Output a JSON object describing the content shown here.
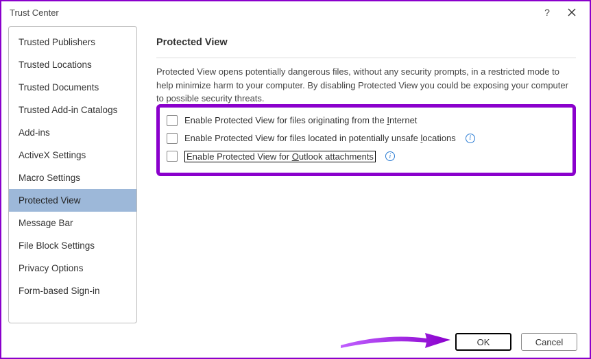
{
  "window": {
    "title": "Trust Center"
  },
  "sidebar": {
    "items": [
      {
        "label": "Trusted Publishers",
        "selected": false
      },
      {
        "label": "Trusted Locations",
        "selected": false
      },
      {
        "label": "Trusted Documents",
        "selected": false
      },
      {
        "label": "Trusted Add-in Catalogs",
        "selected": false
      },
      {
        "label": "Add-ins",
        "selected": false
      },
      {
        "label": "ActiveX Settings",
        "selected": false
      },
      {
        "label": "Macro Settings",
        "selected": false
      },
      {
        "label": "Protected View",
        "selected": true
      },
      {
        "label": "Message Bar",
        "selected": false
      },
      {
        "label": "File Block Settings",
        "selected": false
      },
      {
        "label": "Privacy Options",
        "selected": false
      },
      {
        "label": "Form-based Sign-in",
        "selected": false
      }
    ]
  },
  "main": {
    "heading": "Protected View",
    "description": "Protected View opens potentially dangerous files, without any security prompts, in a restricted mode to help minimize harm to your computer. By disabling Protected View you could be exposing your computer to possible security threats.",
    "options": [
      {
        "label_pre": "Enable Protected View for files originating from the ",
        "underline": "I",
        "label_post": "nternet",
        "checked": false,
        "has_info": false,
        "focused": false
      },
      {
        "label_pre": "Enable Protected View for files located in potentially unsafe ",
        "underline": "l",
        "label_post": "ocations",
        "checked": false,
        "has_info": true,
        "focused": false
      },
      {
        "label_pre": "Enable Protected View for ",
        "underline": "O",
        "label_post": "utlook attachments",
        "checked": false,
        "has_info": true,
        "focused": true
      }
    ]
  },
  "buttons": {
    "ok": "OK",
    "cancel": "Cancel"
  },
  "highlight_color": "#8a00cc"
}
